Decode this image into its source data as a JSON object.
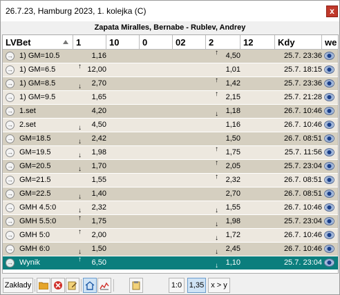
{
  "window": {
    "title": "26.7.23, Hamburg 2023, 1. kolejka (C)",
    "close_label": "x"
  },
  "match": {
    "players": "Zapata Miralles, Bernabe - Rublev, Andrey"
  },
  "columns": [
    "LVBet",
    "1",
    "10",
    "0",
    "02",
    "2",
    "12",
    "Kdy",
    "we"
  ],
  "rows": [
    {
      "name": "1) GM=10.5",
      "odds1": "1,16",
      "odds1_dir": "",
      "odds2": "4,50",
      "odds2_dir": "up",
      "time": "25.7. 23:36",
      "selected": false
    },
    {
      "name": "1) GM=6.5",
      "odds1": "12,00",
      "odds1_dir": "up",
      "odds2": "1,01",
      "odds2_dir": "",
      "time": "25.7. 18:15",
      "selected": false
    },
    {
      "name": "1) GM=8.5",
      "odds1": "2,70",
      "odds1_dir": "down",
      "odds2": "1,42",
      "odds2_dir": "up",
      "time": "25.7. 23:36",
      "selected": false
    },
    {
      "name": "1) GM=9.5",
      "odds1": "1,65",
      "odds1_dir": "",
      "odds2": "2,15",
      "odds2_dir": "up",
      "time": "25.7. 21:28",
      "selected": false
    },
    {
      "name": "1.set",
      "odds1": "4,20",
      "odds1_dir": "",
      "odds2": "1,18",
      "odds2_dir": "down",
      "time": "26.7. 10:46",
      "selected": false
    },
    {
      "name": "2.set",
      "odds1": "4,50",
      "odds1_dir": "down",
      "odds2": "1,16",
      "odds2_dir": "",
      "time": "26.7. 10:46",
      "selected": false
    },
    {
      "name": "GM=18.5",
      "odds1": "2,42",
      "odds1_dir": "down",
      "odds2": "1,50",
      "odds2_dir": "",
      "time": "26.7. 08:51",
      "selected": false
    },
    {
      "name": "GM=19.5",
      "odds1": "1,98",
      "odds1_dir": "down",
      "odds2": "1,75",
      "odds2_dir": "up",
      "time": "25.7. 11:56",
      "selected": false
    },
    {
      "name": "GM=20.5",
      "odds1": "1,70",
      "odds1_dir": "down",
      "odds2": "2,05",
      "odds2_dir": "up",
      "time": "25.7. 23:04",
      "selected": false
    },
    {
      "name": "GM=21.5",
      "odds1": "1,55",
      "odds1_dir": "",
      "odds2": "2,32",
      "odds2_dir": "up",
      "time": "26.7. 08:51",
      "selected": false
    },
    {
      "name": "GM=22.5",
      "odds1": "1,40",
      "odds1_dir": "down",
      "odds2": "2,70",
      "odds2_dir": "",
      "time": "26.7. 08:51",
      "selected": false
    },
    {
      "name": "GMH 4.5:0",
      "odds1": "2,32",
      "odds1_dir": "down",
      "odds2": "1,55",
      "odds2_dir": "down",
      "time": "26.7. 10:46",
      "selected": false
    },
    {
      "name": "GMH 5.5:0",
      "odds1": "1,75",
      "odds1_dir": "up",
      "odds2": "1,98",
      "odds2_dir": "down",
      "time": "25.7. 23:04",
      "selected": false
    },
    {
      "name": "GMH 5:0",
      "odds1": "2,00",
      "odds1_dir": "up",
      "odds2": "1,72",
      "odds2_dir": "down",
      "time": "26.7. 10:46",
      "selected": false
    },
    {
      "name": "GMH 6:0",
      "odds1": "1,50",
      "odds1_dir": "down",
      "odds2": "2,45",
      "odds2_dir": "down",
      "time": "26.7. 10:46",
      "selected": false
    },
    {
      "name": "Wynik",
      "odds1": "6,50",
      "odds1_dir": "up",
      "odds2": "1,10",
      "odds2_dir": "down",
      "time": "25.7. 23:04",
      "selected": true
    }
  ],
  "toolbar": {
    "zaklady_label": "Zakłady",
    "btn_10_label": "1:0",
    "btn_135_label": "1,35",
    "btn_xy_label": "x > y",
    "icons": [
      "folder-icon",
      "close-circle-icon",
      "edit-icon",
      "home-icon",
      "chart-icon",
      "clipboard-icon"
    ]
  },
  "colors": {
    "row_dark": "#d5cfc0",
    "row_light": "#ede8df",
    "selected_row": "#0b7e7d",
    "close_button": "#c0392b"
  }
}
